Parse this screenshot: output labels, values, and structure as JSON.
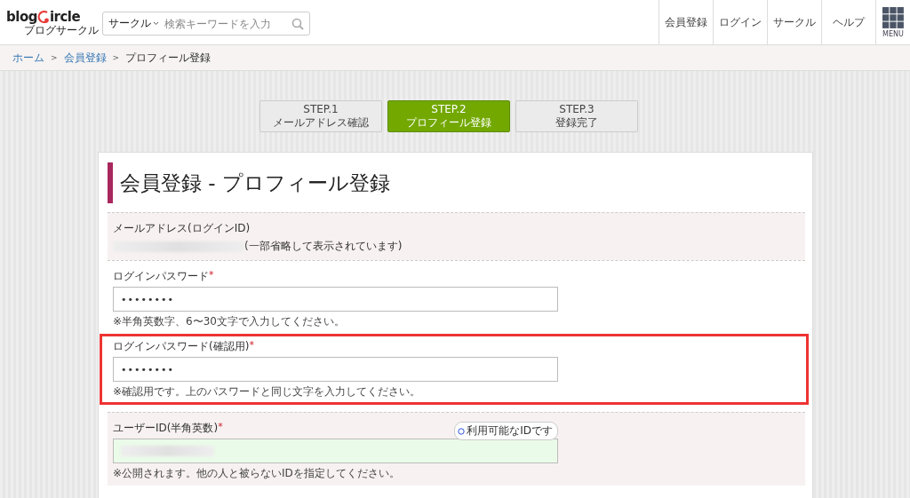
{
  "header": {
    "logo": {
      "before": "blog",
      "after": "ircle",
      "sub": "ブログサークル"
    },
    "search": {
      "category": "サークル",
      "placeholder": "検索キーワードを入力"
    },
    "nav": [
      "会員登録",
      "ログイン",
      "サークル",
      "ヘルプ"
    ],
    "menu_label": "MENU"
  },
  "breadcrumb": [
    {
      "label": "ホーム",
      "link": true
    },
    {
      "label": "会員登録",
      "link": true
    },
    {
      "label": "プロフィール登録",
      "link": false
    }
  ],
  "breadcrumb_separator": ">",
  "steps": [
    {
      "step": "STEP.1",
      "label": "メールアドレス確認",
      "selected": false
    },
    {
      "step": "STEP.2",
      "label": "プロフィール登録",
      "selected": true
    },
    {
      "step": "STEP.3",
      "label": "登録完了",
      "selected": false
    }
  ],
  "title": "会員登録 - プロフィール登録",
  "sections": [
    {
      "kind": "readonly",
      "shaded": true,
      "highlighted": false,
      "label": "メールアドレス(ログインID)",
      "note": "(一部省略して表示されています)"
    },
    {
      "kind": "input",
      "shaded": false,
      "highlighted": false,
      "label": "ログインパスワード",
      "required": true,
      "value": "••••••••",
      "valid": false,
      "hints": [
        "※半角英数字、6〜30文字で入力してください。"
      ]
    },
    {
      "kind": "input",
      "shaded": false,
      "highlighted": true,
      "label": "ログインパスワード(確認用)",
      "required": true,
      "value": "••••••••",
      "valid": false,
      "hints": [
        "※確認用です。上のパスワードと同じ文字を入力してください。"
      ]
    },
    {
      "kind": "input",
      "shaded": true,
      "highlighted": false,
      "label": "ユーザーID(半角英数)",
      "required": true,
      "value_blurred": true,
      "valid": true,
      "status": "利用可能なIDです",
      "hints": [
        "※公開されます。他の人と被らないIDを指定してください。"
      ]
    }
  ],
  "required_mark": "*"
}
